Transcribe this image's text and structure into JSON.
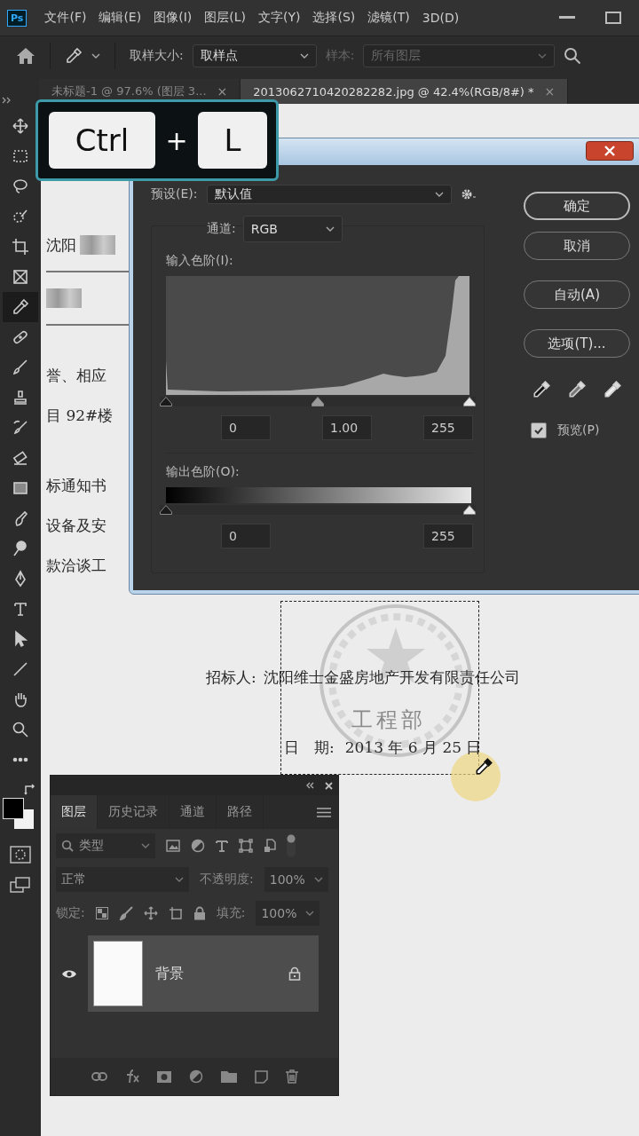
{
  "app": {
    "logo": "Ps",
    "menus": [
      "文件(F)",
      "编辑(E)",
      "图像(I)",
      "图层(L)",
      "文字(Y)",
      "选择(S)",
      "滤镜(T)",
      "3D(D)"
    ]
  },
  "options_bar": {
    "sample_size_label": "取样大小:",
    "sample_size": "取样点",
    "sample_label": "样本:",
    "sample": "所有图层",
    "sample_disabled": true
  },
  "doc_tabs": [
    {
      "title": "未标题-1 @ 97.6% (图层 3...",
      "close": "×",
      "selected": false
    },
    {
      "title": "2013062710420282282.jpg @ 42.4%(RGB/8#) *",
      "close": "×",
      "selected": true
    }
  ],
  "tools": [
    {
      "selected": false
    },
    {
      "selected": false
    },
    {
      "selected": false
    },
    {
      "selected": false
    },
    {
      "selected": false
    },
    {
      "selected": false
    },
    {
      "selected": true
    },
    {
      "selected": false
    },
    {
      "selected": false
    },
    {
      "selected": false
    },
    {
      "selected": false
    },
    {
      "selected": false
    },
    {
      "selected": false
    },
    {
      "selected": false
    },
    {
      "selected": false
    },
    {
      "selected": false
    },
    {
      "selected": false
    },
    {
      "selected": false
    },
    {
      "selected": false
    },
    {
      "selected": false
    },
    {
      "selected": false
    },
    {
      "selected": false
    }
  ],
  "shortcut": {
    "keys": [
      "Ctrl",
      "L"
    ],
    "separator": "+"
  },
  "document": {
    "blocks": [
      {
        "lines": [
          {
            "kind": "redacted",
            "text": "沈阳"
          },
          {
            "kind": "redacted"
          }
        ]
      },
      {
        "lines": [
          {
            "kind": "plain",
            "text": "誉、相应"
          },
          {
            "kind": "plain",
            "text": "目 92#楼"
          }
        ]
      },
      {
        "lines": [
          {
            "kind": "plain",
            "text": "标通知书"
          },
          {
            "kind": "plain",
            "text": "设备及安"
          },
          {
            "kind": "plain",
            "text": "款洽谈工"
          }
        ]
      }
    ],
    "signer_label": "招标人:",
    "signer": "沈阳维士金盛房地产开发有限责任公司",
    "seal_text": "工程部",
    "date_label": "日　期:",
    "date": "2013 年 6 月 25 日"
  },
  "levels_dialog": {
    "preset_label": "预设(E):",
    "preset": "默认值",
    "channel_label": "通道:",
    "channel": "RGB",
    "input_label": "输入色阶(I):",
    "input_handles": [
      {
        "level": 0
      },
      {
        "level": 0.5
      },
      {
        "level": 1
      }
    ],
    "input_values": [
      "0",
      "1.00",
      "255"
    ],
    "output_label": "输出色阶(O):",
    "output_handles": [
      {
        "level": 0
      },
      {
        "level": 1
      }
    ],
    "output_values": [
      "0",
      "255"
    ],
    "buttons": [
      {
        "label": "确定",
        "default": true
      },
      {
        "label": "取消",
        "default": false
      },
      {
        "label": "自动(A)",
        "default": false
      },
      {
        "label": "选项(T)...",
        "default": false
      }
    ],
    "preview": {
      "label": "预览(P)",
      "checked": true
    }
  },
  "layers_panel": {
    "tabs": [
      {
        "label": "图层",
        "selected": true
      },
      {
        "label": "历史记录",
        "selected": false
      },
      {
        "label": "通道",
        "selected": false
      },
      {
        "label": "路径",
        "selected": false
      }
    ],
    "filter_kind": "类型",
    "blend_mode": "正常",
    "opacity_label": "不透明度:",
    "opacity": "100%",
    "lock_label": "锁定:",
    "fill_label": "填充:",
    "fill": "100%",
    "layers": [
      {
        "name": "背景",
        "visible": true,
        "locked": true,
        "selected": true
      }
    ]
  }
}
